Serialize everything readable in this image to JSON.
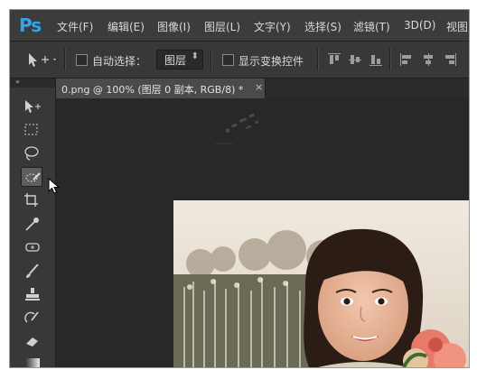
{
  "app": {
    "logo": "Ps"
  },
  "menu": {
    "items": [
      "文件(F)",
      "编辑(E)",
      "图像(I)",
      "图层(L)",
      "文字(Y)",
      "选择(S)",
      "滤镜(T)",
      "3D(D)",
      "视图"
    ]
  },
  "options": {
    "auto_select_label": "自动选择：",
    "auto_select_checked": false,
    "layer_select_value": "图层",
    "show_transform_label": "显示变换控件",
    "show_transform_checked": false
  },
  "panel": {
    "collapse_glyph": "»"
  },
  "document": {
    "tab_title": "0.png @ 100% (图层 0 副本, RGB/8) *",
    "close_glyph": "×"
  },
  "tools": [
    "move-tool",
    "marquee-tool",
    "lasso-tool",
    "quick-selection-tool",
    "crop-tool",
    "eyedropper-tool",
    "healing-brush-tool",
    "brush-tool",
    "clone-stamp-tool",
    "history-brush-tool",
    "eraser-tool",
    "gradient-tool"
  ],
  "colors": {
    "menubar": "#3c3c3c",
    "optionsbar": "#383838",
    "canvas_bg": "#282828",
    "logo": "#33a4e8",
    "selected_tool": "#5e5e5e"
  }
}
